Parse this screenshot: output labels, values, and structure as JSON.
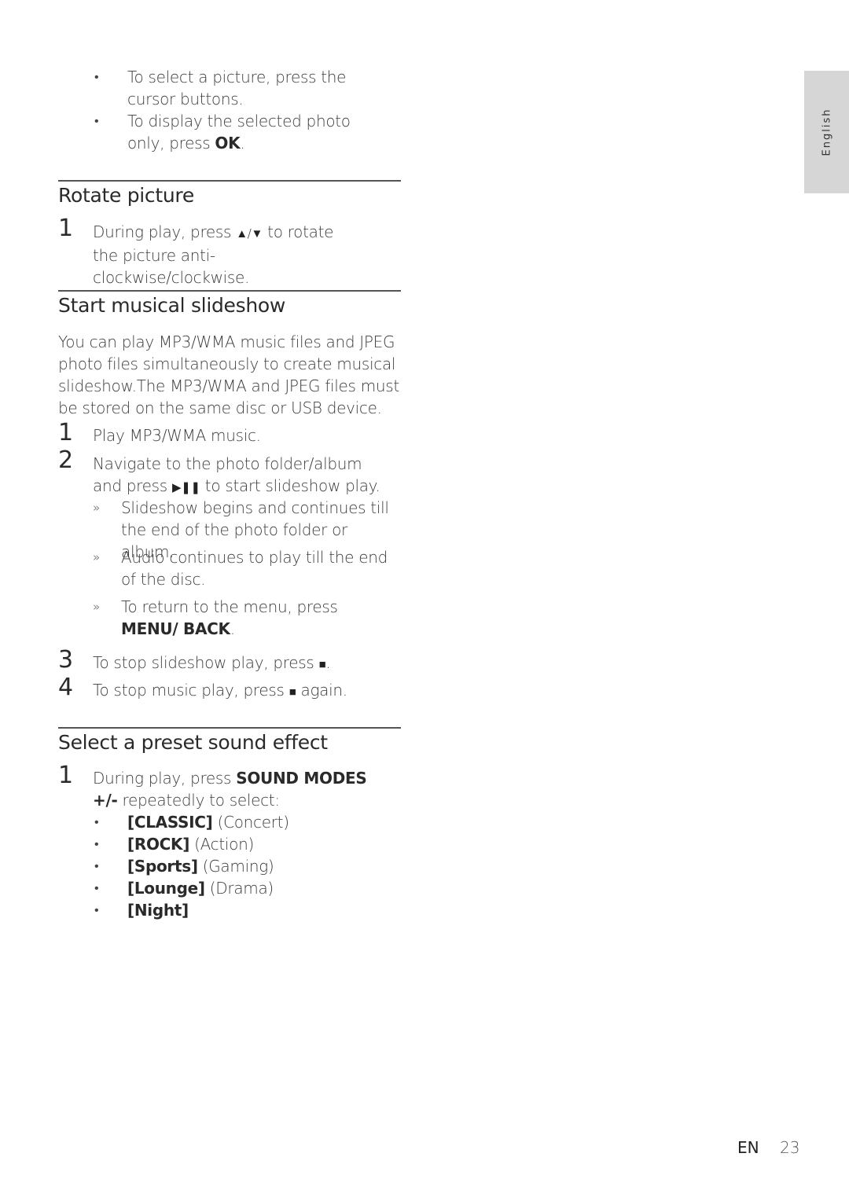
{
  "side_tab": {
    "label": "English"
  },
  "intro_bullets": [
    {
      "text": "To select a picture, press the cursor buttons."
    },
    {
      "text_before": "To display the selected photo only, press ",
      "bold": "OK",
      "text_after": "."
    }
  ],
  "sections": {
    "rotate": {
      "title": "Rotate picture",
      "steps": [
        {
          "num": "1",
          "text_before": "During play, press ",
          "symbol": "▲/▼",
          "text_after": " to rotate the picture anti-clockwise/clockwise."
        }
      ]
    },
    "slideshow": {
      "title": "Start musical slideshow",
      "intro": "You can play MP3/WMA music files and JPEG photo files simultaneously to create musical slideshow.The MP3/WMA and JPEG files must be stored on the same disc or USB device.",
      "steps": [
        {
          "num": "1",
          "text": "Play MP3/WMA music."
        },
        {
          "num": "2",
          "text_before": "Navigate to the photo folder/album and press ",
          "symbol": "▶❚❚",
          "text_after": " to start slideshow play."
        },
        {
          "num": "3",
          "text_before": "To stop slideshow play, press ",
          "symbol": "■",
          "text_after": "."
        },
        {
          "num": "4",
          "text_before": "To stop music play, press ",
          "symbol": "■",
          "text_after": " again."
        }
      ],
      "results": [
        {
          "marker": "»",
          "text": "Slideshow begins and continues till the end of the photo folder or album."
        },
        {
          "marker": "»",
          "text": "Audio continues to play till the end of the disc."
        },
        {
          "marker": "»",
          "text_before": "To return to the menu, press ",
          "bold": "MENU/ BACK",
          "text_after": "."
        }
      ]
    },
    "sound": {
      "title": "Select a preset sound effect",
      "steps": [
        {
          "num": "1",
          "text_before": "During play, press ",
          "bold": "SOUND MODES +/-",
          "text_after": " repeatedly to select:"
        }
      ],
      "options": [
        {
          "bold": "[CLASSIC]",
          "text": " (Concert)"
        },
        {
          "bold": "[ROCK]",
          "text": " (Action)"
        },
        {
          "bold": "[Sports]",
          "text": " (Gaming)"
        },
        {
          "bold": "[Lounge]",
          "text": " (Drama)"
        },
        {
          "bold": "[Night]",
          "text": ""
        }
      ]
    }
  },
  "footer": {
    "lang": "EN",
    "page": "23"
  }
}
